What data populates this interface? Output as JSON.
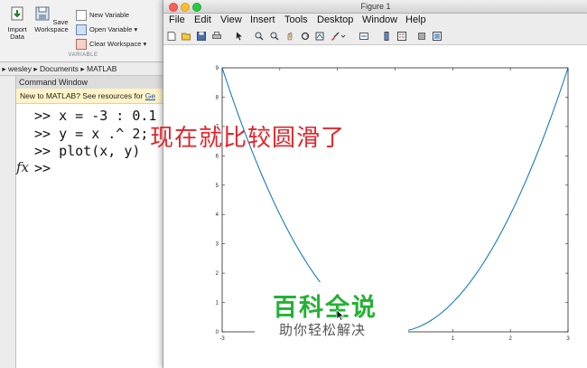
{
  "ribbon": {
    "import_label": "Import\nData",
    "save_label": "Save\nWorkspace",
    "new_variable": "New Variable",
    "open_variable": "Open Variable ▾",
    "clear_workspace": "Clear Workspace ▾",
    "section": "VARIABLE"
  },
  "path": {
    "items": [
      "wesley",
      "Documents",
      "MATLAB"
    ]
  },
  "command_window": {
    "title": "Command Window",
    "banner_text": "New to MATLAB? See resources for ",
    "banner_link": "Ge",
    "lines": [
      ">> x = -3 : 0.1",
      ">> y = x .^ 2;",
      ">> plot(x, y)"
    ],
    "prompt": ">>",
    "fx": "fx"
  },
  "figure": {
    "title": "Figure 1",
    "menu": [
      "File",
      "Edit",
      "View",
      "Insert",
      "Tools",
      "Desktop",
      "Window",
      "Help"
    ],
    "annotation": "现在就比较圆滑了"
  },
  "watermark": {
    "title": "百科全说",
    "subtitle": "助你轻松解决"
  },
  "colors": {
    "line": "#0072bd",
    "annotation": "#e0262b",
    "watermark": "#23b234"
  },
  "chart_data": {
    "type": "line",
    "title": "",
    "xlabel": "",
    "ylabel": "",
    "xlim": [
      -3,
      3
    ],
    "ylim": [
      0,
      9
    ],
    "xticks": [
      "-3",
      "-2",
      "-1",
      "0",
      "1",
      "2",
      "3"
    ],
    "yticks": [
      "0",
      "1",
      "2",
      "3",
      "4",
      "5",
      "6",
      "7",
      "8",
      "9"
    ],
    "grid": false,
    "series": [
      {
        "function": "y = x^2",
        "x_start": -3,
        "x_step": 0.1,
        "x_end": 3
      }
    ]
  }
}
